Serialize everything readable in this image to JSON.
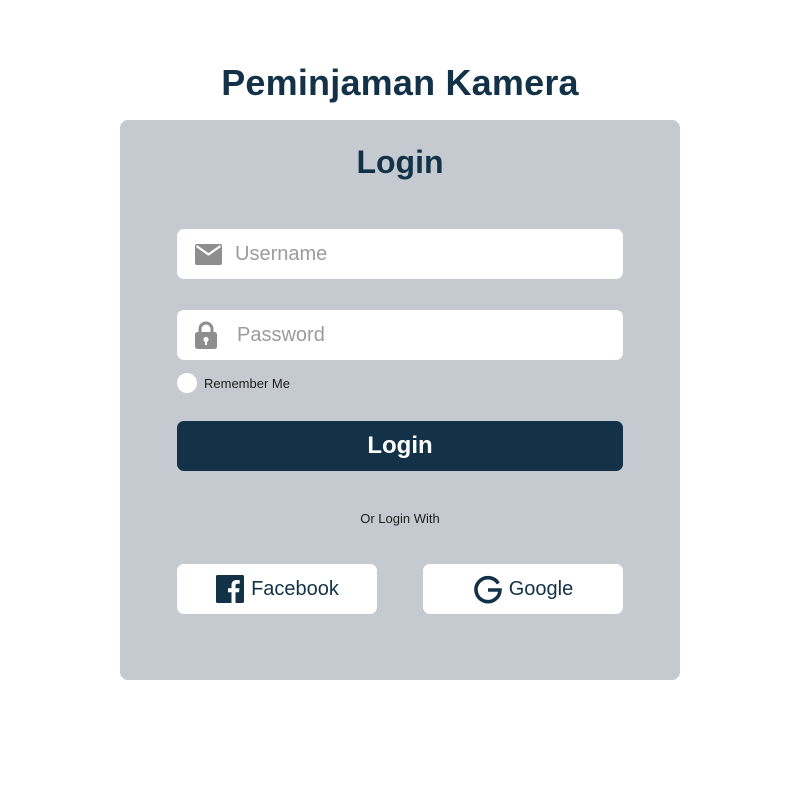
{
  "app": {
    "title": "Peminjaman Kamera"
  },
  "login_card": {
    "title": "Login",
    "username": {
      "placeholder": "Username",
      "value": "",
      "icon": "mail-icon"
    },
    "password": {
      "placeholder": "Password",
      "value": "",
      "icon": "lock-icon"
    },
    "remember_me": {
      "label": "Remember Me",
      "checked": false
    },
    "submit_label": "Login",
    "alt_login_text": "Or Login With",
    "social": {
      "facebook": {
        "label": "Facebook",
        "icon": "facebook-icon"
      },
      "google": {
        "label": "Google",
        "icon": "google-icon"
      }
    }
  },
  "colors": {
    "brand": "#133247",
    "card_bg": "#c4cad0",
    "input_bg": "#ffffff",
    "icon_gray": "#8e8e8e"
  }
}
